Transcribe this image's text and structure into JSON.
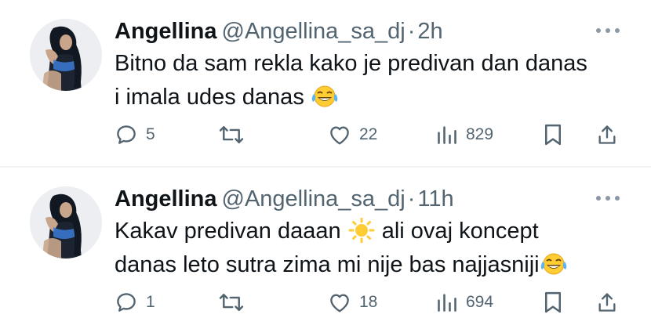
{
  "tweets": [
    {
      "name": "Angellina",
      "handle": "@Angellina_sa_dj",
      "separator": "·",
      "time": "2h",
      "text_line1": "Bitno da sam rekla kako je predivan dan danas",
      "text_line2": "i imala udes danas",
      "emoji_end": "laughing-tears-emoji",
      "replies": "5",
      "likes": "22",
      "views": "829"
    },
    {
      "name": "Angellina",
      "handle": "@Angellina_sa_dj",
      "separator": "·",
      "time": "11h",
      "text_line1a": "Kakav predivan daaan",
      "emoji_mid": "sun-emoji",
      "text_line1b": "ali ovaj koncept",
      "text_line2": "danas leto sutra zima mi nije bas najjasniji",
      "emoji_end": "laughing-tears-emoji",
      "replies": "1",
      "likes": "18",
      "views": "694"
    }
  ],
  "colors": {
    "text": "#0f1419",
    "secondary": "#536471",
    "divider": "#eff3f4",
    "emoji_yellow": "#ffcc33",
    "tears_blue": "#5cb5f3"
  }
}
